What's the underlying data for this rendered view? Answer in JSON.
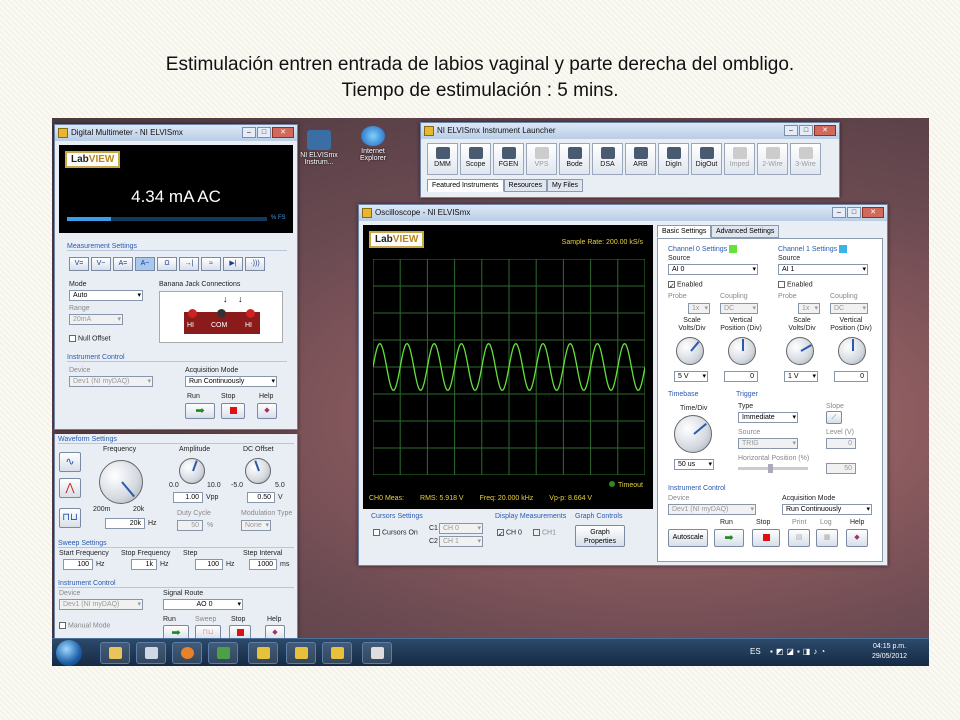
{
  "caption": {
    "line1": "Estimulación entren entrada de labios vaginal y parte  derecha del ombligo.",
    "line2": "Tiempo de estimulación : 5 mins."
  },
  "desktop_icons": [
    {
      "label": "NI ELVISmx Instrum...",
      "icon": "elvis-icon"
    },
    {
      "label": "Internet Explorer",
      "icon": "internet-explorer-icon"
    }
  ],
  "dmm": {
    "title": "Digital Multimeter - NI ELVISmx",
    "reading": "4.34 mA AC",
    "fs_label": "% FS",
    "measurement_settings": "Measurement Settings",
    "mode_buttons": [
      "V=",
      "V~",
      "A=",
      "A~",
      "Ω",
      "→|",
      "≈",
      "▶|",
      "·)))"
    ],
    "mode_label": "Mode",
    "mode_value": "Auto",
    "range_label": "Range",
    "range_value": "20mA",
    "null_offset": "Null Offset",
    "banana_label": "Banana Jack Connections",
    "jacks": [
      "HI",
      "COM",
      "HI"
    ],
    "instrument_control": "Instrument Control",
    "device_label": "Device",
    "device_value": "Dev1 (NI myDAQ)",
    "acq_label": "Acquisition Mode",
    "acq_value": "Run Continuously",
    "run": "Run",
    "stop": "Stop",
    "help": "Help"
  },
  "fgen": {
    "waveform_settings": "Waveform Settings",
    "frequency_label": "Frequency",
    "freq_min": "200m",
    "freq_max": "20k",
    "freq_value": "20k",
    "freq_unit": "Hz",
    "amplitude_label": "Amplitude",
    "amp_min": "0.0",
    "amp_max": "10.0",
    "amp_value": "1.00",
    "amp_unit": "Vpp",
    "dc_label": "DC Offset",
    "dc_min": "-5.0",
    "dc_max": "5.0",
    "dc_value": "0.50",
    "dc_unit": "V",
    "duty_label": "Duty Cycle",
    "duty_value": "50",
    "duty_unit": "%",
    "mod_label": "Modulation Type",
    "mod_value": "None",
    "sweep_settings": "Sweep Settings",
    "start_label": "Start Frequency",
    "start_value": "100",
    "stop_label": "Stop Frequency",
    "stop_value": "1k",
    "step_label": "Step",
    "step_value": "100",
    "interval_label": "Step Interval",
    "interval_value": "1000",
    "hz": "Hz",
    "ms": "ms",
    "instrument_control": "Instrument Control",
    "device_label": "Device",
    "device_value": "Dev1 (NI myDAQ)",
    "signal_label": "Signal Route",
    "signal_value": "AO 0",
    "manual_mode": "Manual Mode",
    "run": "Run",
    "sweep": "Sweep",
    "stop": "Stop",
    "help": "Help"
  },
  "launcher": {
    "title": "NI ELVISmx Instrument Launcher",
    "tools": [
      "DMM",
      "Scope",
      "FGEN",
      "VPS",
      "Bode",
      "DSA",
      "ARB",
      "DigIn",
      "DigOut",
      "Imped",
      "2-Wire",
      "3-Wire"
    ],
    "tabs": [
      "Featured Instruments",
      "Resources",
      "My Files"
    ]
  },
  "scope": {
    "title": "Oscilloscope - NI ELVISmx",
    "sample_rate": "Sample Rate:  200.00 kS/s",
    "timeout": "Timeout",
    "meas": [
      "CH0 Meas:",
      "RMS: 5.918 V",
      "Freq: 20.000 kHz",
      "Vp-p: 8.664 V"
    ],
    "cursors_settings": "Cursors Settings",
    "cursors_on": "Cursors On",
    "c1_label": "C1",
    "c1_value": "CH 0",
    "c2_label": "C2",
    "c2_value": "CH 1",
    "display_meas": "Display Measurements",
    "ch0": "CH 0",
    "ch1": "CH1",
    "graph_controls": "Graph Controls",
    "graph_props": "Graph Properties",
    "tabs": [
      "Basic Settings",
      "Advanced Settings"
    ],
    "ch0_settings": "Channel 0 Settings",
    "ch1_settings": "Channel 1 Settings",
    "ch0_color": "#63e23a",
    "ch1_color": "#3ab4e8",
    "source_label": "Source",
    "ch0_source": "AI 0",
    "ch1_source": "AI 1",
    "enabled": "Enabled",
    "probe_label": "Probe",
    "probe_value": "1x",
    "coupling_label": "Coupling",
    "coupling_value": "DC",
    "scale_label": "Scale Volts/Div",
    "vpos_label": "Vertical Position (Div)",
    "ch0_scale": "5 V",
    "ch1_scale": "1 V",
    "ch0_vpos": "0",
    "ch1_vpos": "0",
    "timebase": "Timebase",
    "timediv_label": "Time/Div",
    "timediv_value": "50 us",
    "trigger": "Trigger",
    "type_label": "Type",
    "type_value": "Immediate",
    "slope_label": "Slope",
    "tsource_label": "Source",
    "tsource_value": "TRIG",
    "level_label": "Level (V)",
    "level_value": "0",
    "hpos_label": "Horizontal Position (%)",
    "hpos_value": "50",
    "instrument_control": "Instrument Control",
    "device_label": "Device",
    "device_value": "Dev1 (NI myDAQ)",
    "acq_label": "Acquisition Mode",
    "acq_value": "Run Continuously",
    "autoscale": "Autoscale",
    "run": "Run",
    "stop": "Stop",
    "print": "Print",
    "log": "Log",
    "help": "Help"
  },
  "taskbar": {
    "lang": "ES",
    "time": "04:15 p.m.",
    "date": "29/05/2012"
  }
}
